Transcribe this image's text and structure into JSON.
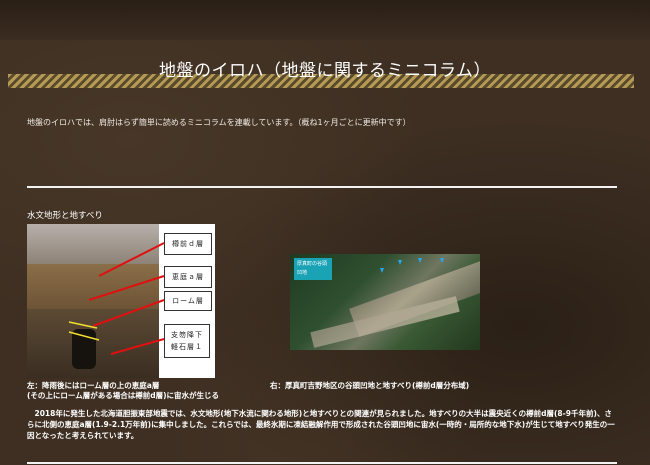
{
  "header": {
    "title": "地盤のイロハ（地盤に関するミニコラム）"
  },
  "intro": "地盤のイロハでは、肩肘はらず簡単に読めるミニコラムを連載しています。（概ね1ヶ月ごとに更新中です）",
  "section": {
    "title": "水文地形と地すべり",
    "left_figure": {
      "labels": [
        "樽前ｄ層",
        "恵庭ａ層",
        "ローム層",
        "支笏降下",
        "軽石層１"
      ]
    },
    "right_figure": {
      "tag": "厚真町の谷頭凹地"
    },
    "caption_left_line1": "左：降雨後にはローム層の上の恵庭a層",
    "caption_left_line2": "(その上にローム層がある場合は樽前d層)に宙水が生じる",
    "caption_right": "右：厚真町吉野地区の谷頭凹地と地すべり(樽前d層分布域)",
    "body": "　2018年に発生した北海道胆振東部地震では、水文地形(地下水流に関わる地形)と地すべりとの関連が見られました。地すべりの大半は震央近くの樽前d層(8-9千年前)、さらに北側の恵庭a層(1.9-2.1万年前)に集中しました。これらでは、最終氷期に凍結融解作用で形成された谷頭凹地に宙水(一時的・局所的な地下水)が生じて地すべり発生の一因となったと考えられています。"
  }
}
